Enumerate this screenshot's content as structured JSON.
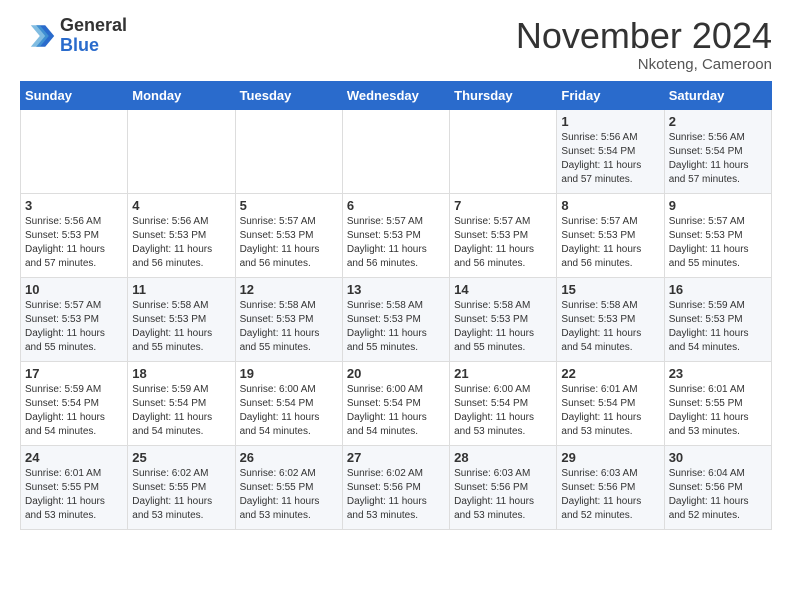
{
  "header": {
    "logo": {
      "general": "General",
      "blue": "Blue"
    },
    "title": "November 2024",
    "location": "Nkoteng, Cameroon"
  },
  "weekdays": [
    "Sunday",
    "Monday",
    "Tuesday",
    "Wednesday",
    "Thursday",
    "Friday",
    "Saturday"
  ],
  "weeks": [
    [
      {
        "day": "",
        "content": ""
      },
      {
        "day": "",
        "content": ""
      },
      {
        "day": "",
        "content": ""
      },
      {
        "day": "",
        "content": ""
      },
      {
        "day": "",
        "content": ""
      },
      {
        "day": "1",
        "content": "Sunrise: 5:56 AM\nSunset: 5:54 PM\nDaylight: 11 hours\nand 57 minutes."
      },
      {
        "day": "2",
        "content": "Sunrise: 5:56 AM\nSunset: 5:54 PM\nDaylight: 11 hours\nand 57 minutes."
      }
    ],
    [
      {
        "day": "3",
        "content": "Sunrise: 5:56 AM\nSunset: 5:53 PM\nDaylight: 11 hours\nand 57 minutes."
      },
      {
        "day": "4",
        "content": "Sunrise: 5:56 AM\nSunset: 5:53 PM\nDaylight: 11 hours\nand 56 minutes."
      },
      {
        "day": "5",
        "content": "Sunrise: 5:57 AM\nSunset: 5:53 PM\nDaylight: 11 hours\nand 56 minutes."
      },
      {
        "day": "6",
        "content": "Sunrise: 5:57 AM\nSunset: 5:53 PM\nDaylight: 11 hours\nand 56 minutes."
      },
      {
        "day": "7",
        "content": "Sunrise: 5:57 AM\nSunset: 5:53 PM\nDaylight: 11 hours\nand 56 minutes."
      },
      {
        "day": "8",
        "content": "Sunrise: 5:57 AM\nSunset: 5:53 PM\nDaylight: 11 hours\nand 56 minutes."
      },
      {
        "day": "9",
        "content": "Sunrise: 5:57 AM\nSunset: 5:53 PM\nDaylight: 11 hours\nand 55 minutes."
      }
    ],
    [
      {
        "day": "10",
        "content": "Sunrise: 5:57 AM\nSunset: 5:53 PM\nDaylight: 11 hours\nand 55 minutes."
      },
      {
        "day": "11",
        "content": "Sunrise: 5:58 AM\nSunset: 5:53 PM\nDaylight: 11 hours\nand 55 minutes."
      },
      {
        "day": "12",
        "content": "Sunrise: 5:58 AM\nSunset: 5:53 PM\nDaylight: 11 hours\nand 55 minutes."
      },
      {
        "day": "13",
        "content": "Sunrise: 5:58 AM\nSunset: 5:53 PM\nDaylight: 11 hours\nand 55 minutes."
      },
      {
        "day": "14",
        "content": "Sunrise: 5:58 AM\nSunset: 5:53 PM\nDaylight: 11 hours\nand 55 minutes."
      },
      {
        "day": "15",
        "content": "Sunrise: 5:58 AM\nSunset: 5:53 PM\nDaylight: 11 hours\nand 54 minutes."
      },
      {
        "day": "16",
        "content": "Sunrise: 5:59 AM\nSunset: 5:53 PM\nDaylight: 11 hours\nand 54 minutes."
      }
    ],
    [
      {
        "day": "17",
        "content": "Sunrise: 5:59 AM\nSunset: 5:54 PM\nDaylight: 11 hours\nand 54 minutes."
      },
      {
        "day": "18",
        "content": "Sunrise: 5:59 AM\nSunset: 5:54 PM\nDaylight: 11 hours\nand 54 minutes."
      },
      {
        "day": "19",
        "content": "Sunrise: 6:00 AM\nSunset: 5:54 PM\nDaylight: 11 hours\nand 54 minutes."
      },
      {
        "day": "20",
        "content": "Sunrise: 6:00 AM\nSunset: 5:54 PM\nDaylight: 11 hours\nand 54 minutes."
      },
      {
        "day": "21",
        "content": "Sunrise: 6:00 AM\nSunset: 5:54 PM\nDaylight: 11 hours\nand 53 minutes."
      },
      {
        "day": "22",
        "content": "Sunrise: 6:01 AM\nSunset: 5:54 PM\nDaylight: 11 hours\nand 53 minutes."
      },
      {
        "day": "23",
        "content": "Sunrise: 6:01 AM\nSunset: 5:55 PM\nDaylight: 11 hours\nand 53 minutes."
      }
    ],
    [
      {
        "day": "24",
        "content": "Sunrise: 6:01 AM\nSunset: 5:55 PM\nDaylight: 11 hours\nand 53 minutes."
      },
      {
        "day": "25",
        "content": "Sunrise: 6:02 AM\nSunset: 5:55 PM\nDaylight: 11 hours\nand 53 minutes."
      },
      {
        "day": "26",
        "content": "Sunrise: 6:02 AM\nSunset: 5:55 PM\nDaylight: 11 hours\nand 53 minutes."
      },
      {
        "day": "27",
        "content": "Sunrise: 6:02 AM\nSunset: 5:56 PM\nDaylight: 11 hours\nand 53 minutes."
      },
      {
        "day": "28",
        "content": "Sunrise: 6:03 AM\nSunset: 5:56 PM\nDaylight: 11 hours\nand 53 minutes."
      },
      {
        "day": "29",
        "content": "Sunrise: 6:03 AM\nSunset: 5:56 PM\nDaylight: 11 hours\nand 52 minutes."
      },
      {
        "day": "30",
        "content": "Sunrise: 6:04 AM\nSunset: 5:56 PM\nDaylight: 11 hours\nand 52 minutes."
      }
    ]
  ]
}
